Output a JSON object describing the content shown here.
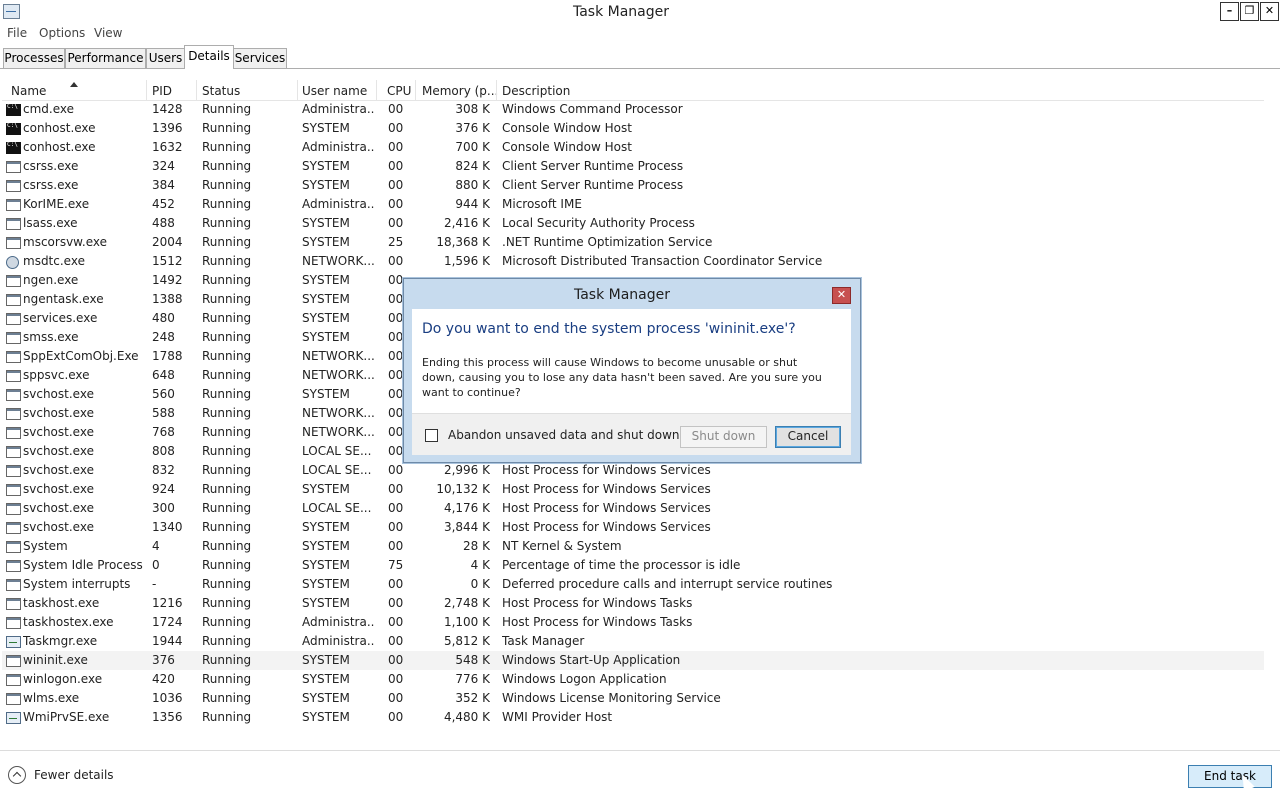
{
  "window": {
    "title": "Task Manager",
    "minimize": "–",
    "maximize": "❐",
    "close": "✕"
  },
  "menu": [
    "File",
    "Options",
    "View"
  ],
  "tabs": [
    {
      "label": "Processes",
      "active": false
    },
    {
      "label": "Performance",
      "active": false
    },
    {
      "label": "Users",
      "active": false
    },
    {
      "label": "Details",
      "active": true
    },
    {
      "label": "Services",
      "active": false
    }
  ],
  "columns": {
    "name": "Name",
    "pid": "PID",
    "status": "Status",
    "user": "User name",
    "cpu": "CPU",
    "memory": "Memory (p...",
    "description": "Description"
  },
  "rows": [
    {
      "icon": "cmd",
      "name": "cmd.exe",
      "pid": "1428",
      "status": "Running",
      "user": "Administra...",
      "cpu": "00",
      "memory": "308 K",
      "description": "Windows Command Processor"
    },
    {
      "icon": "cmd",
      "name": "conhost.exe",
      "pid": "1396",
      "status": "Running",
      "user": "SYSTEM",
      "cpu": "00",
      "memory": "376 K",
      "description": "Console Window Host"
    },
    {
      "icon": "cmd",
      "name": "conhost.exe",
      "pid": "1632",
      "status": "Running",
      "user": "Administra...",
      "cpu": "00",
      "memory": "700 K",
      "description": "Console Window Host"
    },
    {
      "icon": "win",
      "name": "csrss.exe",
      "pid": "324",
      "status": "Running",
      "user": "SYSTEM",
      "cpu": "00",
      "memory": "824 K",
      "description": "Client Server Runtime Process"
    },
    {
      "icon": "win",
      "name": "csrss.exe",
      "pid": "384",
      "status": "Running",
      "user": "SYSTEM",
      "cpu": "00",
      "memory": "880 K",
      "description": "Client Server Runtime Process"
    },
    {
      "icon": "win",
      "name": "KorIME.exe",
      "pid": "452",
      "status": "Running",
      "user": "Administra...",
      "cpu": "00",
      "memory": "944 K",
      "description": "Microsoft IME"
    },
    {
      "icon": "win",
      "name": "lsass.exe",
      "pid": "488",
      "status": "Running",
      "user": "SYSTEM",
      "cpu": "00",
      "memory": "2,416 K",
      "description": "Local Security Authority Process"
    },
    {
      "icon": "win",
      "name": "mscorsvw.exe",
      "pid": "2004",
      "status": "Running",
      "user": "SYSTEM",
      "cpu": "25",
      "memory": "18,368 K",
      "description": ".NET Runtime Optimization Service"
    },
    {
      "icon": "gear",
      "name": "msdtc.exe",
      "pid": "1512",
      "status": "Running",
      "user": "NETWORK...",
      "cpu": "00",
      "memory": "1,596 K",
      "description": "Microsoft Distributed Transaction Coordinator Service"
    },
    {
      "icon": "win",
      "name": "ngen.exe",
      "pid": "1492",
      "status": "Running",
      "user": "SYSTEM",
      "cpu": "00",
      "memory": "",
      "description": ""
    },
    {
      "icon": "win",
      "name": "ngentask.exe",
      "pid": "1388",
      "status": "Running",
      "user": "SYSTEM",
      "cpu": "00",
      "memory": "",
      "description": ""
    },
    {
      "icon": "win",
      "name": "services.exe",
      "pid": "480",
      "status": "Running",
      "user": "SYSTEM",
      "cpu": "00",
      "memory": "",
      "description": ""
    },
    {
      "icon": "win",
      "name": "smss.exe",
      "pid": "248",
      "status": "Running",
      "user": "SYSTEM",
      "cpu": "00",
      "memory": "",
      "description": ""
    },
    {
      "icon": "win",
      "name": "SppExtComObj.Exe",
      "pid": "1788",
      "status": "Running",
      "user": "NETWORK...",
      "cpu": "00",
      "memory": "",
      "description": ""
    },
    {
      "icon": "win",
      "name": "sppsvc.exe",
      "pid": "648",
      "status": "Running",
      "user": "NETWORK...",
      "cpu": "00",
      "memory": "",
      "description": ""
    },
    {
      "icon": "win",
      "name": "svchost.exe",
      "pid": "560",
      "status": "Running",
      "user": "SYSTEM",
      "cpu": "00",
      "memory": "",
      "description": ""
    },
    {
      "icon": "win",
      "name": "svchost.exe",
      "pid": "588",
      "status": "Running",
      "user": "NETWORK...",
      "cpu": "00",
      "memory": "",
      "description": ""
    },
    {
      "icon": "win",
      "name": "svchost.exe",
      "pid": "768",
      "status": "Running",
      "user": "NETWORK...",
      "cpu": "00",
      "memory": "",
      "description": ""
    },
    {
      "icon": "win",
      "name": "svchost.exe",
      "pid": "808",
      "status": "Running",
      "user": "LOCAL SE...",
      "cpu": "00",
      "memory": "",
      "description": ""
    },
    {
      "icon": "win",
      "name": "svchost.exe",
      "pid": "832",
      "status": "Running",
      "user": "LOCAL SE...",
      "cpu": "00",
      "memory": "2,996 K",
      "description": "Host Process for Windows Services"
    },
    {
      "icon": "win",
      "name": "svchost.exe",
      "pid": "924",
      "status": "Running",
      "user": "SYSTEM",
      "cpu": "00",
      "memory": "10,132 K",
      "description": "Host Process for Windows Services"
    },
    {
      "icon": "win",
      "name": "svchost.exe",
      "pid": "300",
      "status": "Running",
      "user": "LOCAL SE...",
      "cpu": "00",
      "memory": "4,176 K",
      "description": "Host Process for Windows Services"
    },
    {
      "icon": "win",
      "name": "svchost.exe",
      "pid": "1340",
      "status": "Running",
      "user": "SYSTEM",
      "cpu": "00",
      "memory": "3,844 K",
      "description": "Host Process for Windows Services"
    },
    {
      "icon": "win",
      "name": "System",
      "pid": "4",
      "status": "Running",
      "user": "SYSTEM",
      "cpu": "00",
      "memory": "28 K",
      "description": "NT Kernel & System"
    },
    {
      "icon": "win",
      "name": "System Idle Process",
      "pid": "0",
      "status": "Running",
      "user": "SYSTEM",
      "cpu": "75",
      "memory": "4 K",
      "description": "Percentage of time the processor is idle"
    },
    {
      "icon": "win",
      "name": "System interrupts",
      "pid": "-",
      "status": "Running",
      "user": "SYSTEM",
      "cpu": "00",
      "memory": "0 K",
      "description": "Deferred procedure calls and interrupt service routines"
    },
    {
      "icon": "win",
      "name": "taskhost.exe",
      "pid": "1216",
      "status": "Running",
      "user": "SYSTEM",
      "cpu": "00",
      "memory": "2,748 K",
      "description": "Host Process for Windows Tasks"
    },
    {
      "icon": "win",
      "name": "taskhostex.exe",
      "pid": "1724",
      "status": "Running",
      "user": "Administra...",
      "cpu": "00",
      "memory": "1,100 K",
      "description": "Host Process for Windows Tasks"
    },
    {
      "icon": "tm",
      "name": "Taskmgr.exe",
      "pid": "1944",
      "status": "Running",
      "user": "Administra...",
      "cpu": "00",
      "memory": "5,812 K",
      "description": "Task Manager"
    },
    {
      "icon": "win",
      "name": "wininit.exe",
      "pid": "376",
      "status": "Running",
      "user": "SYSTEM",
      "cpu": "00",
      "memory": "548 K",
      "description": "Windows Start-Up Application",
      "selected": true
    },
    {
      "icon": "win",
      "name": "winlogon.exe",
      "pid": "420",
      "status": "Running",
      "user": "SYSTEM",
      "cpu": "00",
      "memory": "776 K",
      "description": "Windows Logon Application"
    },
    {
      "icon": "win",
      "name": "wlms.exe",
      "pid": "1036",
      "status": "Running",
      "user": "SYSTEM",
      "cpu": "00",
      "memory": "352 K",
      "description": "Windows License Monitoring Service"
    },
    {
      "icon": "tm",
      "name": "WmiPrvSE.exe",
      "pid": "1356",
      "status": "Running",
      "user": "SYSTEM",
      "cpu": "00",
      "memory": "4,480 K",
      "description": "WMI Provider Host"
    }
  ],
  "dialog": {
    "title": "Task Manager",
    "close": "✕",
    "main_instruction": "Do you want to end the system process 'wininit.exe'?",
    "content": "Ending this process will cause Windows to become unusable or shut down, causing you to lose any data hasn't been saved. Are you sure you want to continue?",
    "checkbox_label": "Abandon unsaved data and shut down.",
    "shutdown_label": "Shut down",
    "cancel_label": "Cancel"
  },
  "footer": {
    "fewer_details": "Fewer details",
    "end_task": "End task"
  }
}
